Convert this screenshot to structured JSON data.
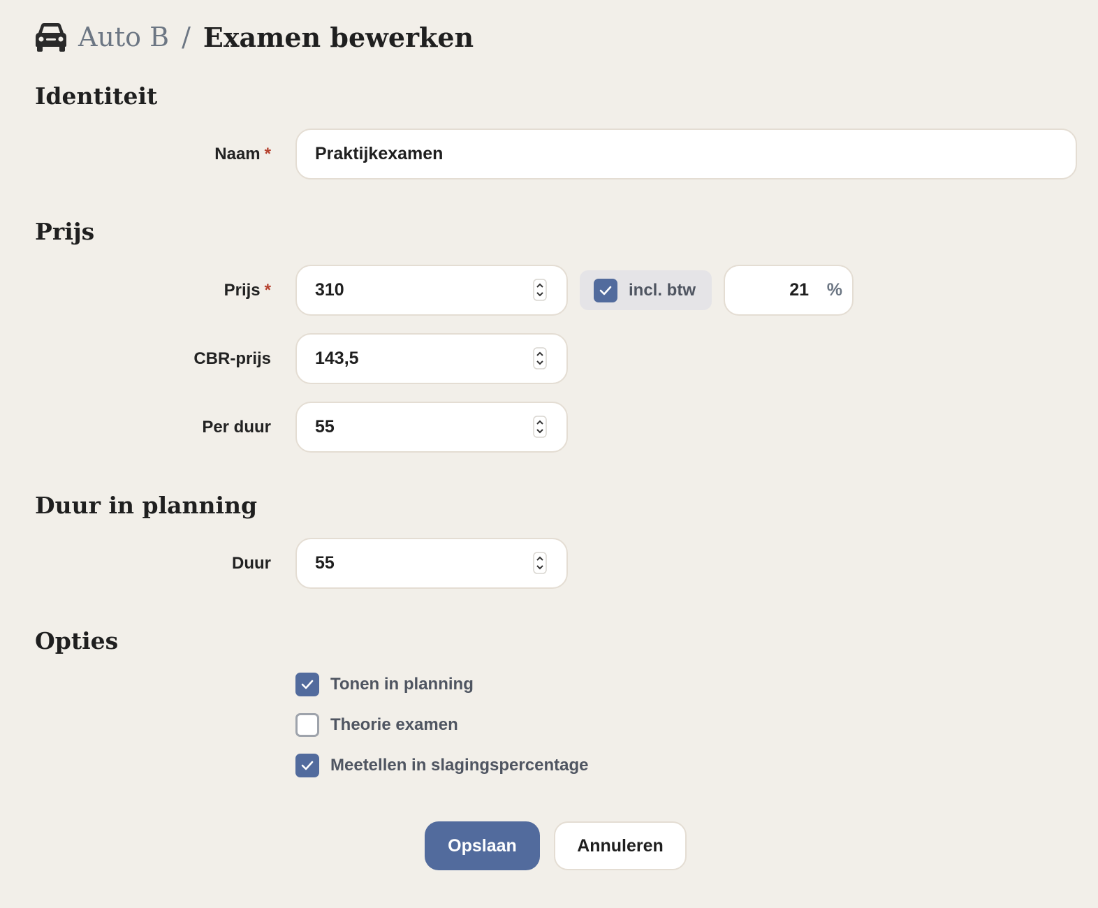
{
  "header": {
    "icon": "car-icon",
    "parent": "Auto B",
    "separator": "/",
    "title": "Examen bewerken"
  },
  "sections": {
    "identity": "Identiteit",
    "price": "Prijs",
    "duration": "Duur in planning",
    "options": "Opties"
  },
  "fields": {
    "naam": {
      "label": "Naam",
      "required": "*",
      "value": "Praktijkexamen"
    },
    "prijs": {
      "label": "Prijs",
      "required": "*",
      "value": "310"
    },
    "incl_btw": {
      "label": "incl. btw",
      "checked": true
    },
    "btw_pct": {
      "value": "21",
      "unit": "%"
    },
    "cbr_prijs": {
      "label": "CBR-prijs",
      "value": "143,5"
    },
    "per_duur": {
      "label": "Per duur",
      "value": "55"
    },
    "duur": {
      "label": "Duur",
      "value": "55"
    }
  },
  "options": [
    {
      "label": "Tonen in planning",
      "checked": true
    },
    {
      "label": "Theorie examen",
      "checked": false
    },
    {
      "label": "Meetellen in slagingspercentage",
      "checked": true
    }
  ],
  "buttons": {
    "save": "Opslaan",
    "cancel": "Annuleren"
  },
  "colors": {
    "accent": "#526b9d",
    "background": "#f2efe9",
    "required": "#b5412e"
  }
}
